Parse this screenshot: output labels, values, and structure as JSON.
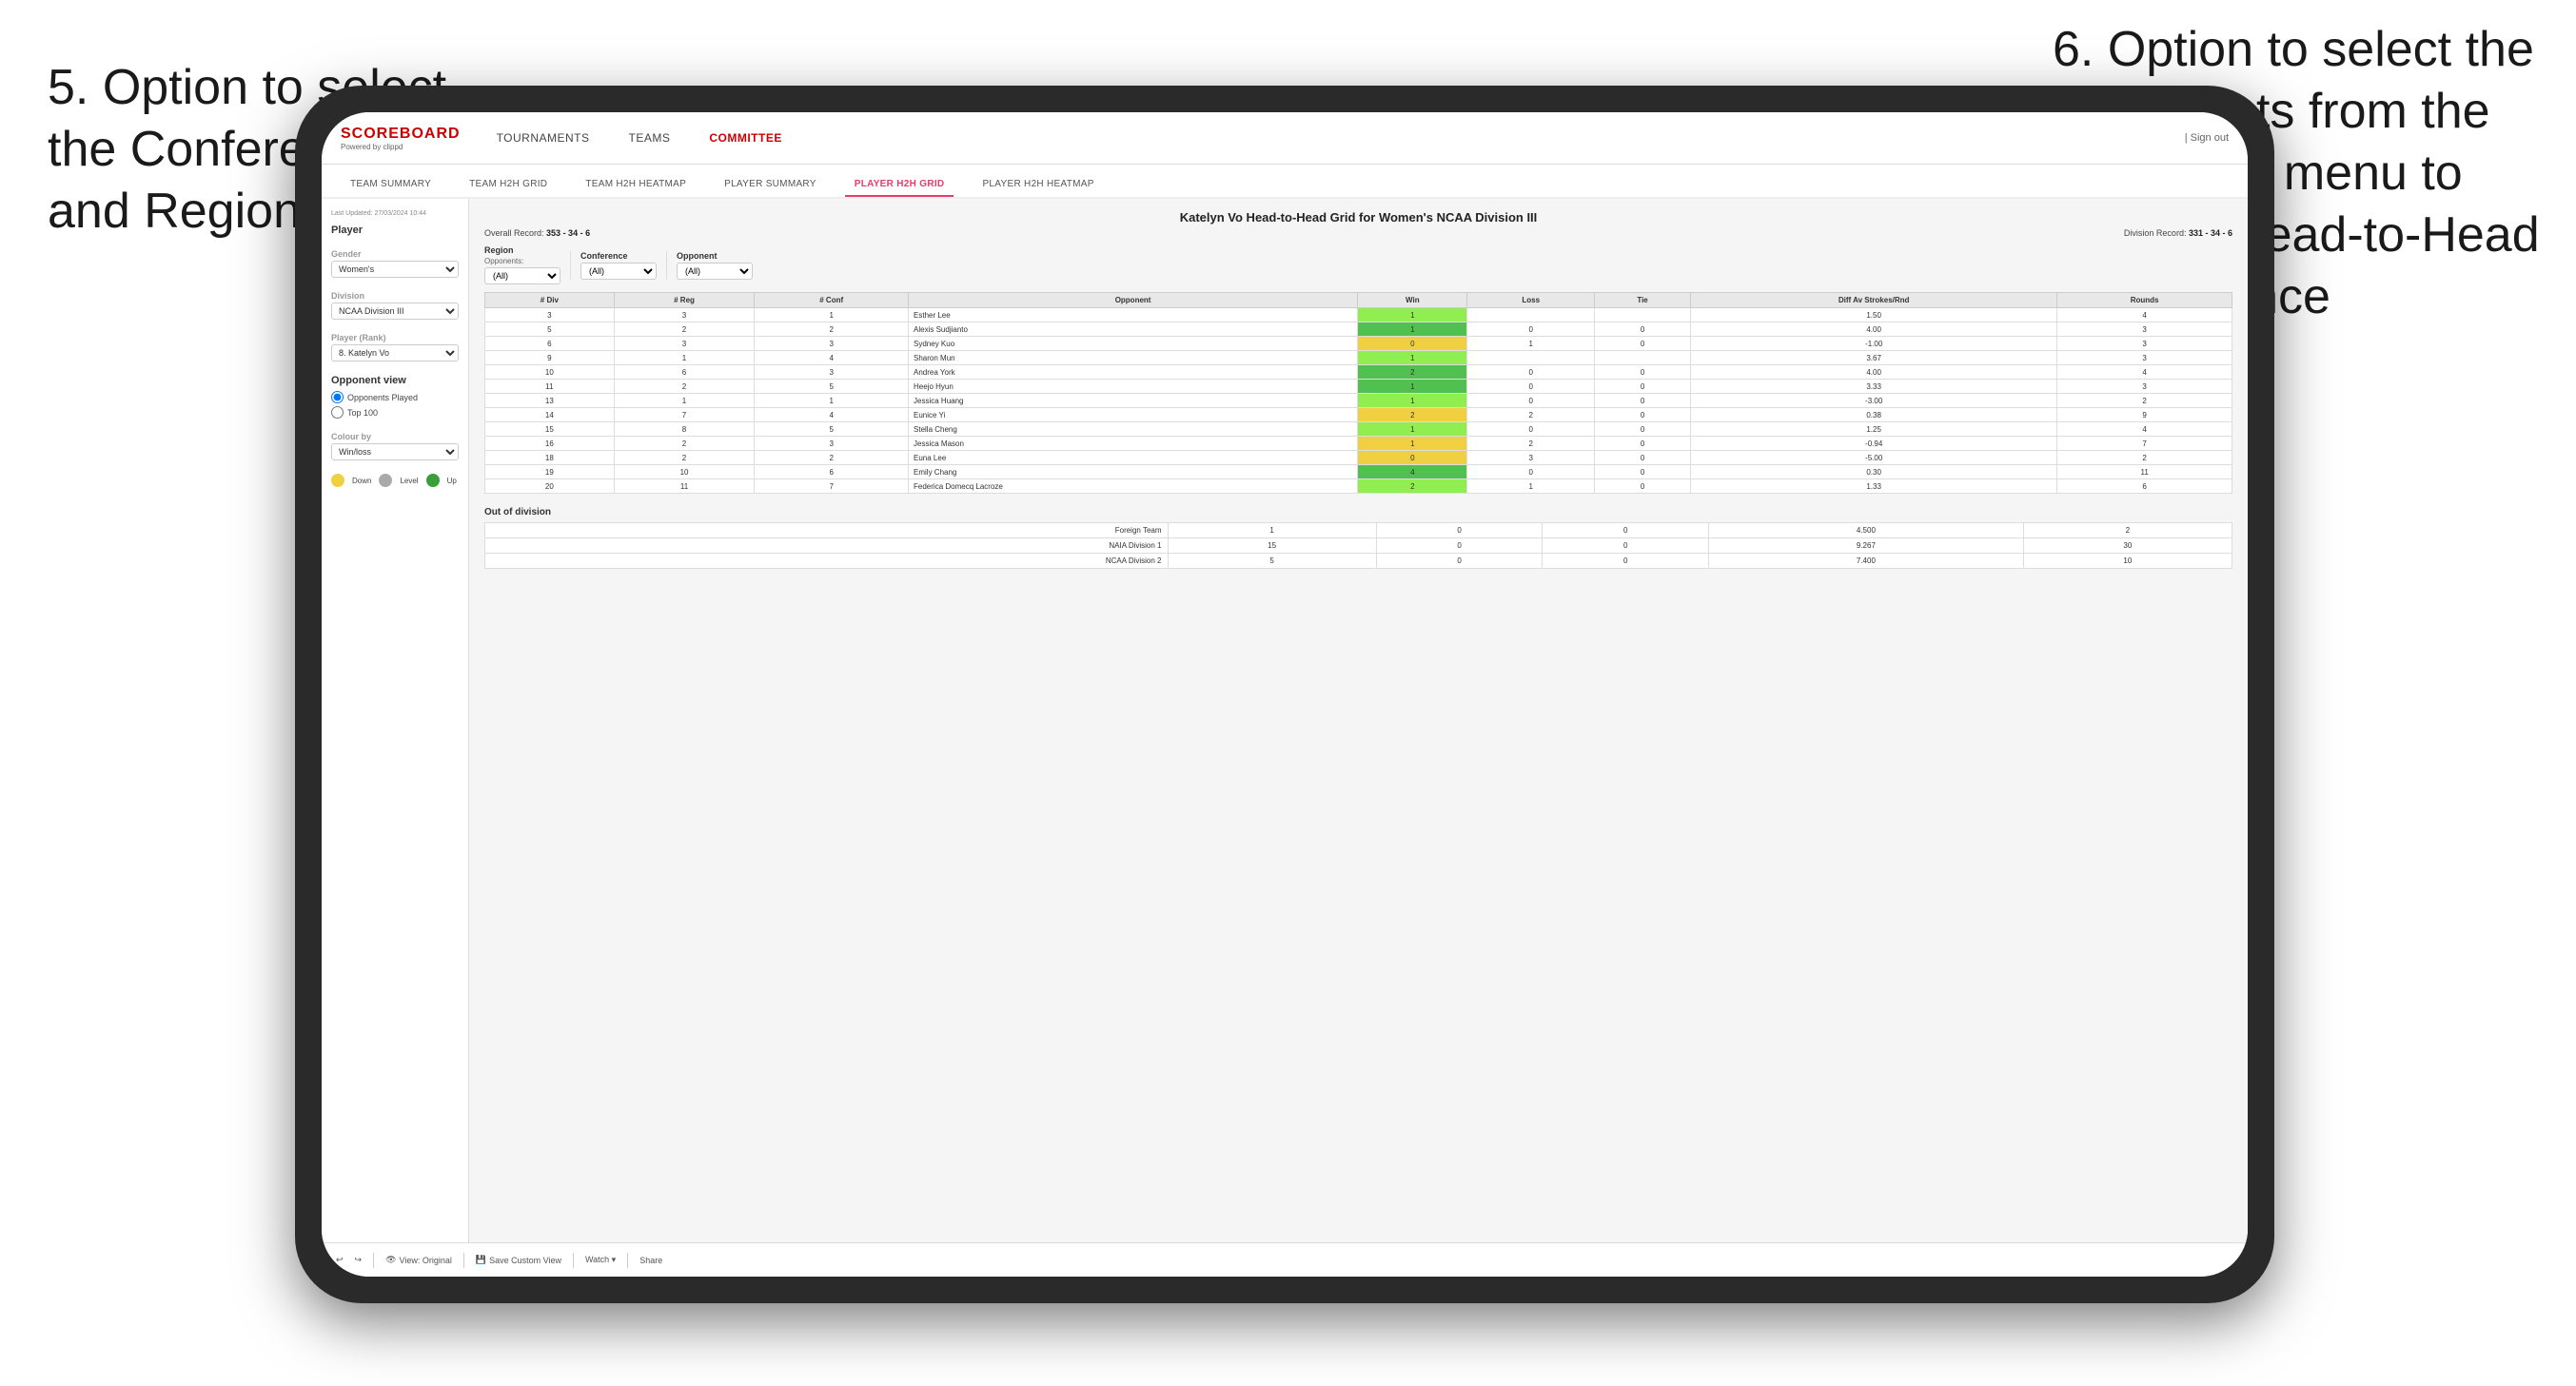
{
  "annotations": {
    "left": "5. Option to select the Conference and Region",
    "right": "6. Option to select the Opponents from the dropdown menu to see the Head-to-Head performance"
  },
  "nav": {
    "logo": "SCOREBOARD",
    "logo_sub": "Powered by clippd",
    "items": [
      "TOURNAMENTS",
      "TEAMS",
      "COMMITTEE"
    ],
    "active_item": "COMMITTEE",
    "sign_out": "| Sign out"
  },
  "sub_nav": {
    "items": [
      "TEAM SUMMARY",
      "TEAM H2H GRID",
      "TEAM H2H HEATMAP",
      "PLAYER SUMMARY",
      "PLAYER H2H GRID",
      "PLAYER H2H HEATMAP"
    ],
    "active": "PLAYER H2H GRID"
  },
  "sidebar": {
    "last_updated": "Last Updated: 27/03/2024 10:44",
    "player_label": "Player",
    "gender_label": "Gender",
    "gender_value": "Women's",
    "division_label": "Division",
    "division_value": "NCAA Division III",
    "player_rank_label": "Player (Rank)",
    "player_rank_value": "8. Katelyn Vo",
    "opponent_view_label": "Opponent view",
    "opponent_options": [
      "Opponents Played",
      "Top 100"
    ],
    "opponent_selected": "Opponents Played",
    "colour_by_label": "Colour by",
    "colour_by_value": "Win/loss",
    "legend": {
      "down_label": "Down",
      "level_label": "Level",
      "up_label": "Up"
    }
  },
  "report": {
    "title": "Katelyn Vo Head-to-Head Grid for Women's NCAA Division III",
    "overall_record_label": "Overall Record:",
    "overall_record_value": "353 - 34 - 6",
    "division_record_label": "Division Record:",
    "division_record_value": "331 - 34 - 6"
  },
  "filters": {
    "region_label": "Region",
    "opponents_label": "Opponents:",
    "region_value": "(All)",
    "conference_label": "Conference",
    "conference_value": "(All)",
    "opponent_label": "Opponent",
    "opponent_value": "(All)"
  },
  "table": {
    "headers": [
      "# Div",
      "# Reg",
      "# Conf",
      "Opponent",
      "Win",
      "Loss",
      "Tie",
      "Diff Av Strokes/Rnd",
      "Rounds"
    ],
    "rows": [
      {
        "div": "3",
        "reg": "3",
        "conf": "1",
        "opponent": "Esther Lee",
        "win": "1",
        "loss": "",
        "tie": "",
        "diff": "1.50",
        "rounds": "4",
        "win_color": "green-light"
      },
      {
        "div": "5",
        "reg": "2",
        "conf": "2",
        "opponent": "Alexis Sudjianto",
        "win": "1",
        "loss": "0",
        "tie": "0",
        "diff": "4.00",
        "rounds": "3",
        "win_color": "green-mid"
      },
      {
        "div": "6",
        "reg": "3",
        "conf": "3",
        "opponent": "Sydney Kuo",
        "win": "0",
        "loss": "1",
        "tie": "0",
        "diff": "-1.00",
        "rounds": "3",
        "win_color": "yellow"
      },
      {
        "div": "9",
        "reg": "1",
        "conf": "4",
        "opponent": "Sharon Mun",
        "win": "1",
        "loss": "",
        "tie": "",
        "diff": "3.67",
        "rounds": "3",
        "win_color": "green-light"
      },
      {
        "div": "10",
        "reg": "6",
        "conf": "3",
        "opponent": "Andrea York",
        "win": "2",
        "loss": "0",
        "tie": "0",
        "diff": "4.00",
        "rounds": "4",
        "win_color": "green-mid"
      },
      {
        "div": "11",
        "reg": "2",
        "conf": "5",
        "opponent": "Heejo Hyun",
        "win": "1",
        "loss": "0",
        "tie": "0",
        "diff": "3.33",
        "rounds": "3",
        "win_color": "green-mid"
      },
      {
        "div": "13",
        "reg": "1",
        "conf": "1",
        "opponent": "Jessica Huang",
        "win": "1",
        "loss": "0",
        "tie": "0",
        "diff": "-3.00",
        "rounds": "2",
        "win_color": "green-light"
      },
      {
        "div": "14",
        "reg": "7",
        "conf": "4",
        "opponent": "Eunice Yi",
        "win": "2",
        "loss": "2",
        "tie": "0",
        "diff": "0.38",
        "rounds": "9",
        "win_color": "yellow"
      },
      {
        "div": "15",
        "reg": "8",
        "conf": "5",
        "opponent": "Stella Cheng",
        "win": "1",
        "loss": "0",
        "tie": "0",
        "diff": "1.25",
        "rounds": "4",
        "win_color": "green-light"
      },
      {
        "div": "16",
        "reg": "2",
        "conf": "3",
        "opponent": "Jessica Mason",
        "win": "1",
        "loss": "2",
        "tie": "0",
        "diff": "-0.94",
        "rounds": "7",
        "win_color": "yellow"
      },
      {
        "div": "18",
        "reg": "2",
        "conf": "2",
        "opponent": "Euna Lee",
        "win": "0",
        "loss": "3",
        "tie": "0",
        "diff": "-5.00",
        "rounds": "2",
        "win_color": "yellow"
      },
      {
        "div": "19",
        "reg": "10",
        "conf": "6",
        "opponent": "Emily Chang",
        "win": "4",
        "loss": "0",
        "tie": "0",
        "diff": "0.30",
        "rounds": "11",
        "win_color": "green-mid"
      },
      {
        "div": "20",
        "reg": "11",
        "conf": "7",
        "opponent": "Federica Domecq Lacroze",
        "win": "2",
        "loss": "1",
        "tie": "0",
        "diff": "1.33",
        "rounds": "6",
        "win_color": "green-light"
      }
    ]
  },
  "out_of_division": {
    "title": "Out of division",
    "rows": [
      {
        "name": "Foreign Team",
        "win": "1",
        "loss": "0",
        "tie": "0",
        "diff": "4.500",
        "rounds": "2"
      },
      {
        "name": "NAIA Division 1",
        "win": "15",
        "loss": "0",
        "tie": "0",
        "diff": "9.267",
        "rounds": "30"
      },
      {
        "name": "NCAA Division 2",
        "win": "5",
        "loss": "0",
        "tie": "0",
        "diff": "7.400",
        "rounds": "10"
      }
    ]
  },
  "toolbar": {
    "view_original": "View: Original",
    "save_custom": "Save Custom View",
    "watch": "Watch ▾",
    "share": "Share"
  }
}
